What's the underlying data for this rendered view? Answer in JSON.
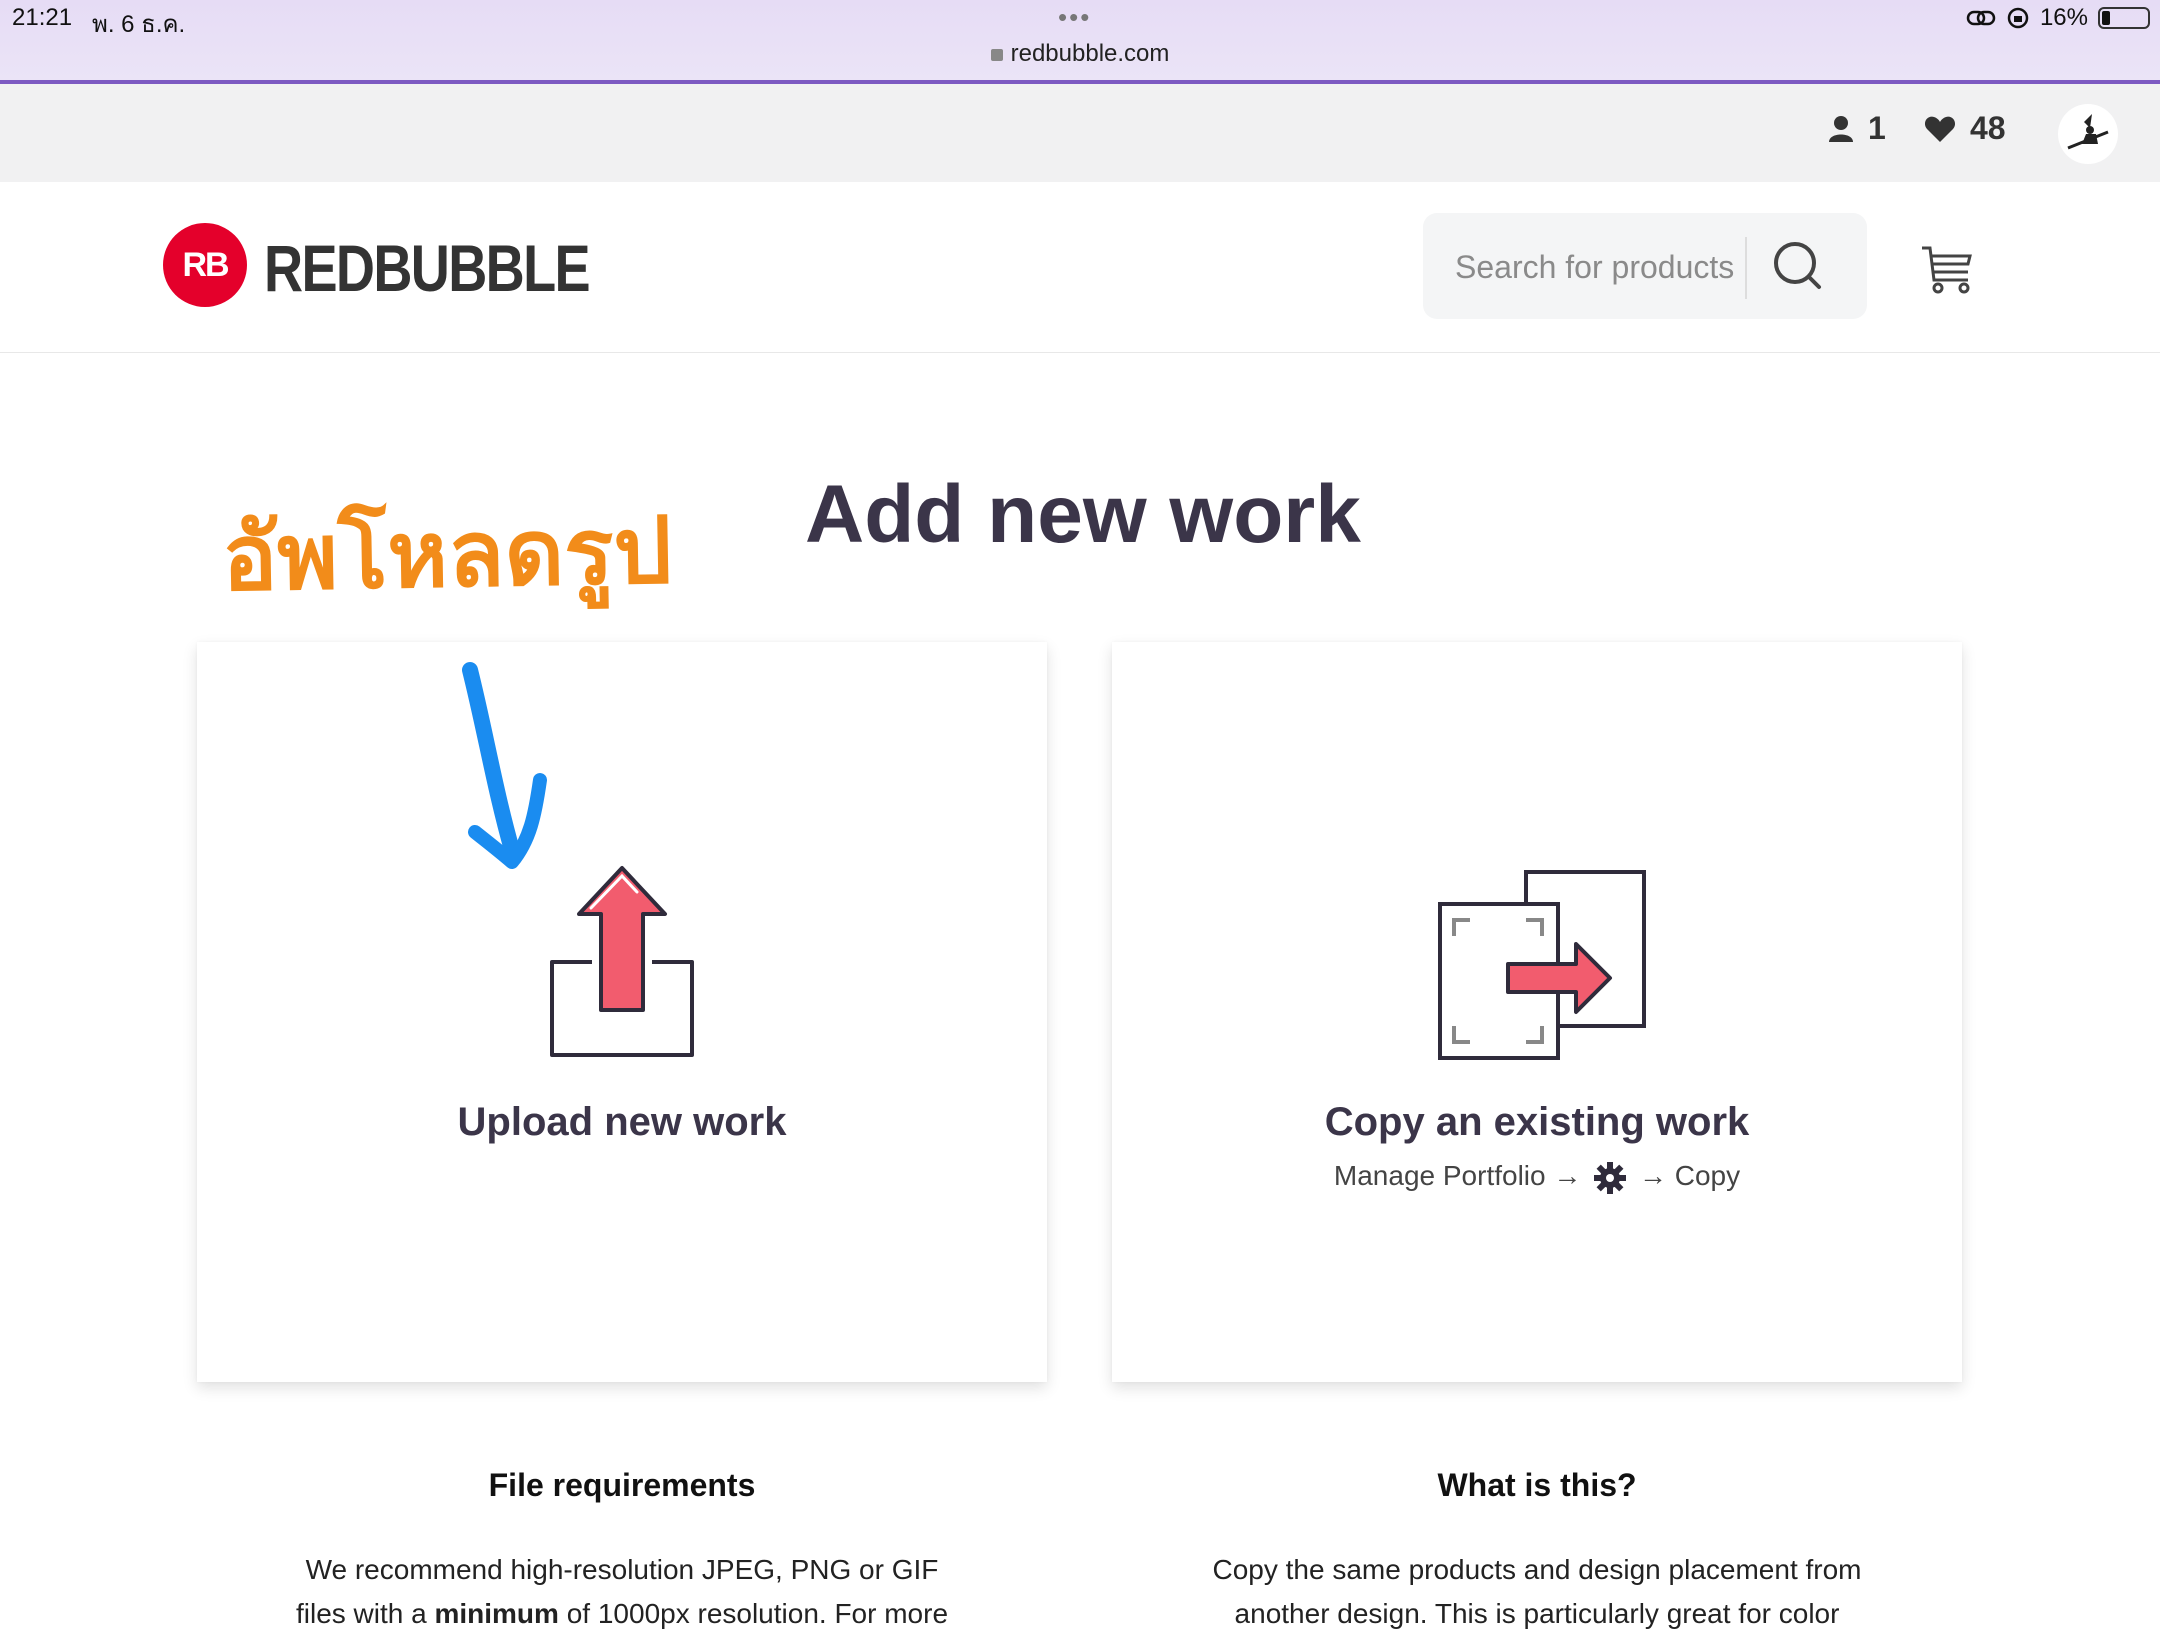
{
  "status_bar": {
    "time": "21:21",
    "date": "พ. 6 ธ.ค.",
    "dots": "•••",
    "url": "redbubble.com",
    "battery": "16%"
  },
  "topbar": {
    "user_count": "1",
    "favorites_count": "48"
  },
  "header": {
    "logo_badge": "RB",
    "logo_text": "REDBUBBLE",
    "search_placeholder": "Search for products"
  },
  "annotation": {
    "thai_text": "อัพโหลดรูป",
    "arrow_color": "#1a8cf0"
  },
  "page": {
    "title": "Add new work"
  },
  "cards": {
    "upload": {
      "title": "Upload new work"
    },
    "copy": {
      "title": "Copy an existing work",
      "path_start": "Manage Portfolio →",
      "path_end": "→ Copy"
    }
  },
  "sections": {
    "file_requirements": {
      "title": "File requirements",
      "body_1": "We recommend high-resolution JPEG, PNG or GIF",
      "body_2_pre": "files with a ",
      "body_2_bold": "minimum",
      "body_2_post": " of 1000px resolution. For more"
    },
    "what_is_this": {
      "title": "What is this?",
      "body_1": "Copy the same products and design placement from",
      "body_2": "another design. This is particularly great for color"
    }
  },
  "colors": {
    "brand_red": "#e4002b",
    "accent_purple": "#7d5ac2",
    "icon_red": "#f25c6e",
    "title_dark": "#3b3549",
    "annotation_orange": "#f28c1a"
  }
}
